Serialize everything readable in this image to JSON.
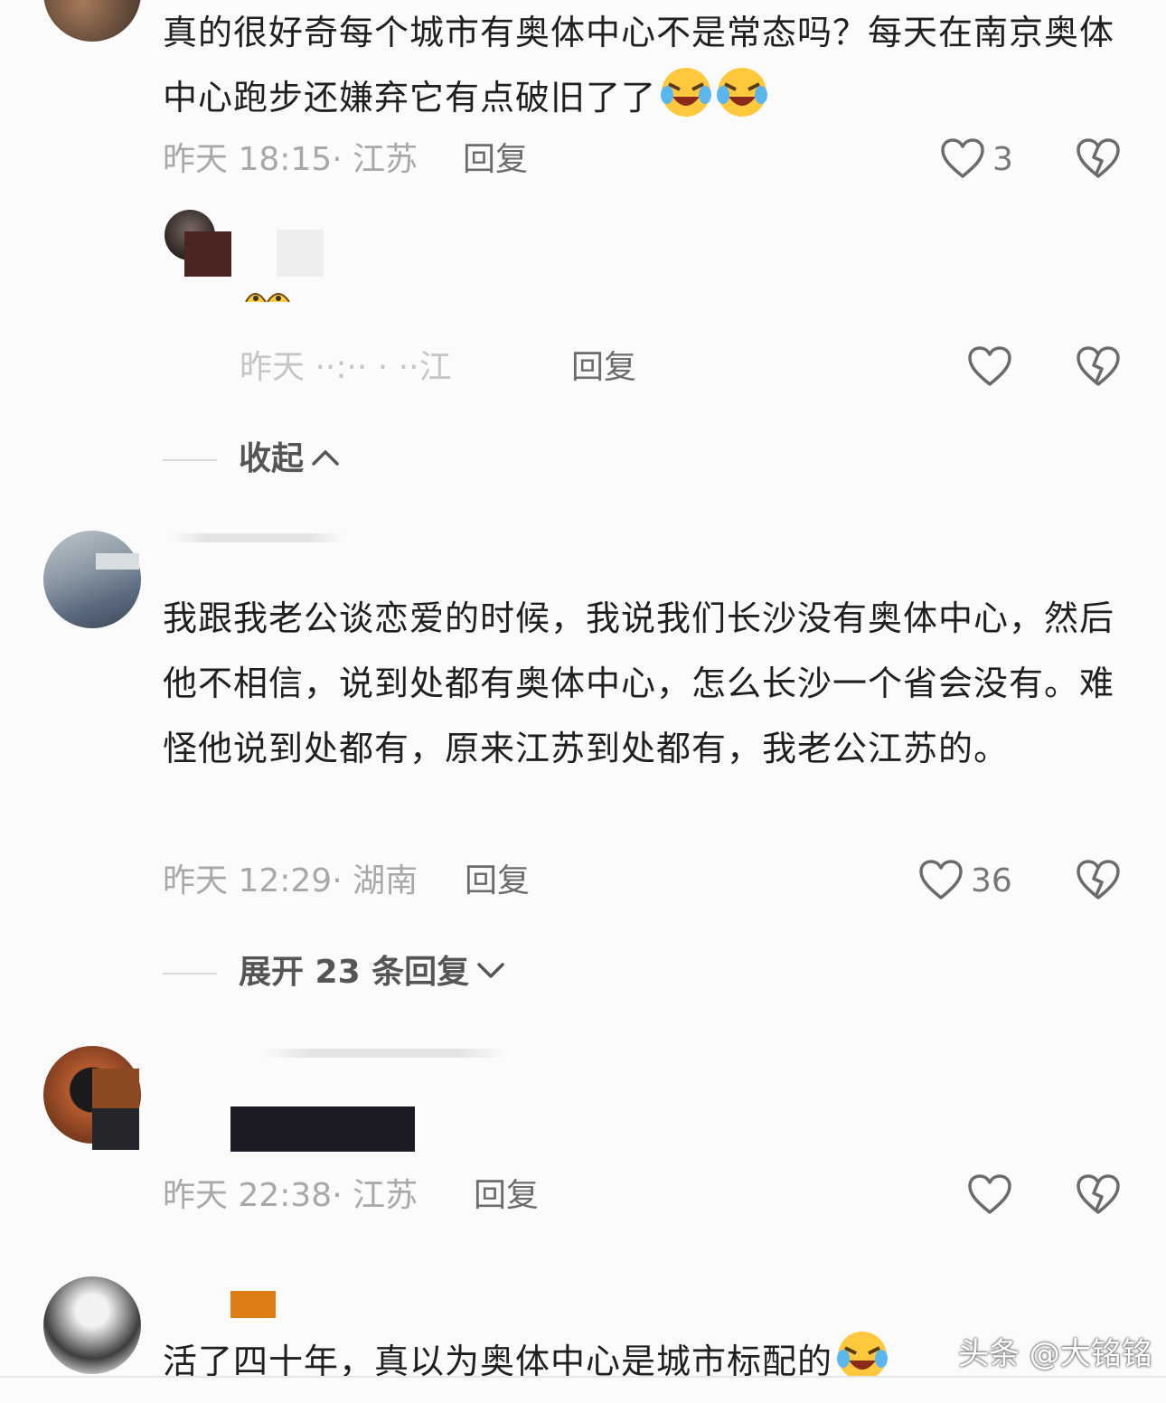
{
  "comments": [
    {
      "text": "真的很好奇每个城市有奥体中心不是常态吗？每天在南京奥体中心跑步还嫌弃它有点破旧了了",
      "meta": "昨天 18:15· 江苏",
      "reply": "回复",
      "likes": "3",
      "emoji": "laughing-crying"
    },
    {
      "meta": "昨天 ··:·· · ··江",
      "reply": "回复"
    },
    {
      "fold": "收起"
    },
    {
      "text": "我跟我老公谈恋爱的时候，我说我们长沙没有奥体中心，然后他不相信，说到处都有奥体中心，怎么长沙一个省会没有。难怪他说到处都有，原来江苏到处都有，我老公江苏的。",
      "meta": "昨天 12:29· 湖南",
      "reply": "回复",
      "likes": "36",
      "expand": "展开 23 条回复"
    },
    {
      "meta": "昨天 22:38· 江苏",
      "reply": "回复"
    },
    {
      "text": "活了四十年，真以为奥体中心是城市标配的",
      "emoji": "laughing-crying"
    }
  ],
  "watermark": "头条 @大铭铭",
  "colors": {
    "heart": "#6b6b6b",
    "meta": "#a8a8a8",
    "redact_dark": "#1c1c24",
    "redact_brown": "#4b2622",
    "redact_orange": "#dd7b14"
  }
}
